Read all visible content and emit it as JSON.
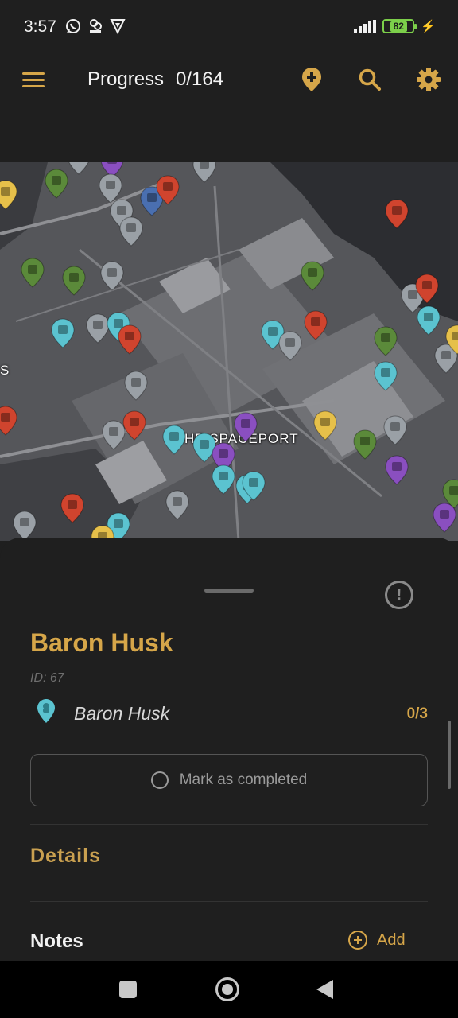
{
  "status_bar": {
    "time": "3:57",
    "left_icons": [
      "whatsapp-icon",
      "game-notification-icon",
      "vpn-shield-icon"
    ],
    "battery_level": "82",
    "charging": true
  },
  "app_bar": {
    "menu_icon": "hamburger-menu-icon",
    "progress_label": "Progress",
    "progress_value": "0/164",
    "actions": [
      "add-marker-icon",
      "search-icon",
      "settings-gear-icon"
    ],
    "accent_color": "#d6a649"
  },
  "map": {
    "location_label": "HE SPACEPORT",
    "edge_label": "S",
    "marker_colors": {
      "cyan": "#5bc3d0",
      "red": "#d0442e",
      "green": "#5b8a3a",
      "purple": "#8a4fc0",
      "yellow": "#e6c04a",
      "grey": "#9aa0a6",
      "blue": "#4a6fb0"
    }
  },
  "bottom_sheet": {
    "title": "Baron Husk",
    "id_text": "ID: 67",
    "category": {
      "label": "Baron Husk",
      "count": "0/3",
      "icon": "map-pin-icon",
      "color": "#5bc3d0"
    },
    "mark_button_label": "Mark as completed",
    "details_heading": "Details",
    "notes_heading": "Notes",
    "add_label": "Add",
    "report_icon": "report-issue-icon"
  },
  "nav_bar": {
    "buttons": [
      "recents-button",
      "home-button",
      "back-button"
    ]
  }
}
